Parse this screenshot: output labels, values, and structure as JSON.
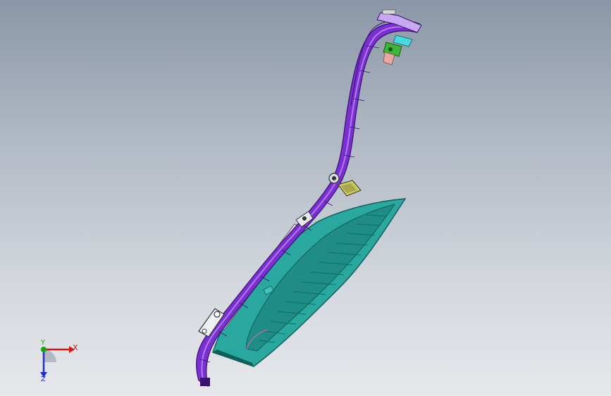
{
  "view": {
    "background_top": "#8b97a8",
    "background_bottom": "#e6e8ec"
  },
  "model": {
    "rail_color": "#7a2fd0",
    "rail_highlight": "#b07af0",
    "panel_color": "#2aa8a0",
    "panel_dark": "#137a74",
    "bracket_color": "#c8cc6a",
    "clip_color": "#3fb43a",
    "pad_color": "#e8a8a0"
  },
  "triad": {
    "x_label": "X",
    "y_label": "Y",
    "z_label": "Z",
    "x_color": "#d01818",
    "y_color": "#14a414",
    "z_color": "#2430c8"
  }
}
